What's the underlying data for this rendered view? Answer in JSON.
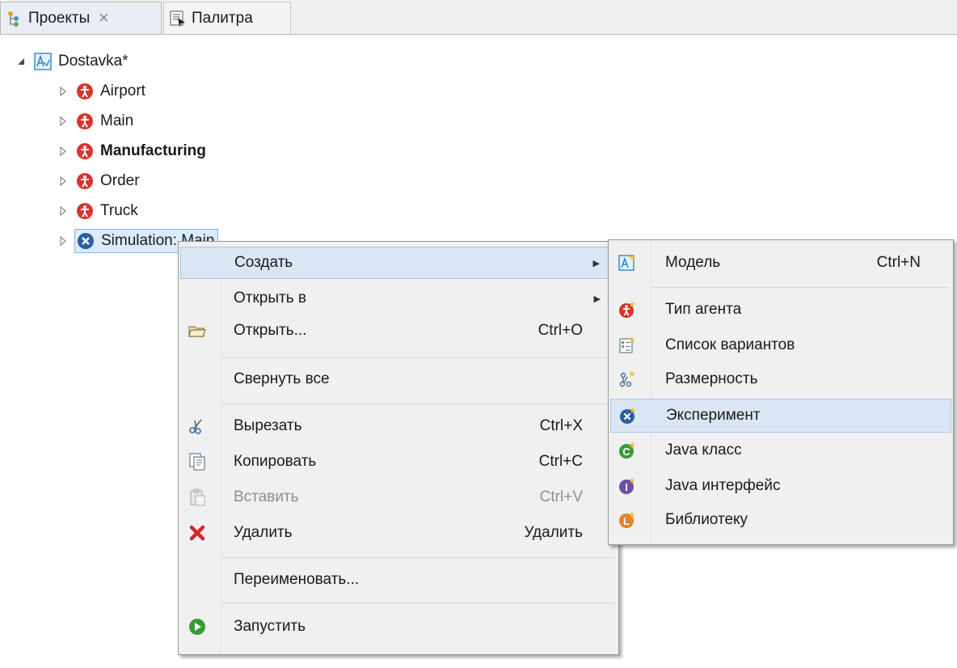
{
  "tabs": [
    {
      "label": "Проекты",
      "close": "✕"
    },
    {
      "label": "Палитра"
    }
  ],
  "tree": {
    "root": "Dostavka*",
    "children": [
      {
        "label": "Airport",
        "bold": false
      },
      {
        "label": "Main",
        "bold": false
      },
      {
        "label": "Manufacturing",
        "bold": true
      },
      {
        "label": "Order",
        "bold": false
      },
      {
        "label": "Truck",
        "bold": false
      }
    ],
    "selected": "Simulation: Main"
  },
  "context_menu": {
    "items": [
      {
        "label": "Создать",
        "shortcut": "",
        "submenu": true
      },
      {
        "label": "Открыть в",
        "shortcut": "",
        "submenu": true
      },
      {
        "label": "Открыть...",
        "shortcut": "Ctrl+O"
      },
      {
        "label": "Свернуть все",
        "shortcut": ""
      },
      {
        "label": "Вырезать",
        "shortcut": "Ctrl+X"
      },
      {
        "label": "Копировать",
        "shortcut": "Ctrl+C"
      },
      {
        "label": "Вставить",
        "shortcut": "Ctrl+V",
        "disabled": true
      },
      {
        "label": "Удалить",
        "shortcut": "Удалить"
      },
      {
        "label": "Переименовать...",
        "shortcut": ""
      },
      {
        "label": "Запустить",
        "shortcut": ""
      }
    ],
    "submenu_arrow": "▶"
  },
  "submenu": {
    "items": [
      {
        "label": "Модель",
        "shortcut": "Ctrl+N"
      },
      {
        "label": "Тип агента",
        "shortcut": ""
      },
      {
        "label": "Список вариантов",
        "shortcut": ""
      },
      {
        "label": "Размерность",
        "shortcut": ""
      },
      {
        "label": "Эксперимент",
        "shortcut": ""
      },
      {
        "label": "Java класс",
        "shortcut": ""
      },
      {
        "label": "Java интерфейс",
        "shortcut": ""
      },
      {
        "label": "Библиотеку",
        "shortcut": ""
      }
    ]
  },
  "colors": {
    "highlight": "#dbe6f4",
    "agent_red": "#d9342b",
    "experiment_blue": "#2d5f9e",
    "run_green": "#3a9a3a"
  }
}
